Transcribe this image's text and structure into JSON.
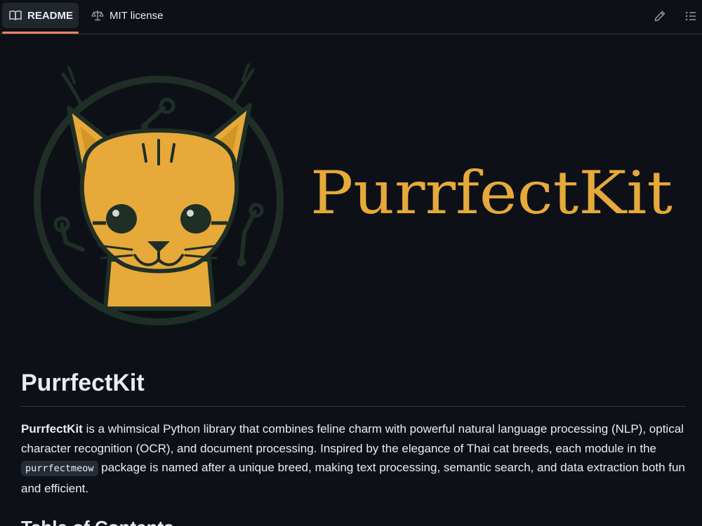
{
  "tabs": {
    "readme_label": "README",
    "license_label": "MIT license"
  },
  "toolbar": {
    "edit_icon": "pencil-icon",
    "outline_icon": "list-unordered-icon"
  },
  "banner": {
    "logo_text": "PurrfectKit",
    "colors": {
      "accent_gold": "#e6a93a",
      "ring_green": "#1f2f26",
      "background": "#0d1117"
    }
  },
  "content": {
    "title": "PurrfectKit",
    "intro_strong": "PurrfectKit",
    "intro_part1": " is a whimsical Python library that combines feline charm with powerful natural language processing (NLP), optical character recognition (OCR), and document processing. Inspired by the elegance of Thai cat breeds, each module in the ",
    "intro_code": "purrfectmeow",
    "intro_part2": " package is named after a unique breed, making text processing, semantic search, and data extraction both fun and efficient.",
    "toc_heading": "Table of Contents"
  }
}
